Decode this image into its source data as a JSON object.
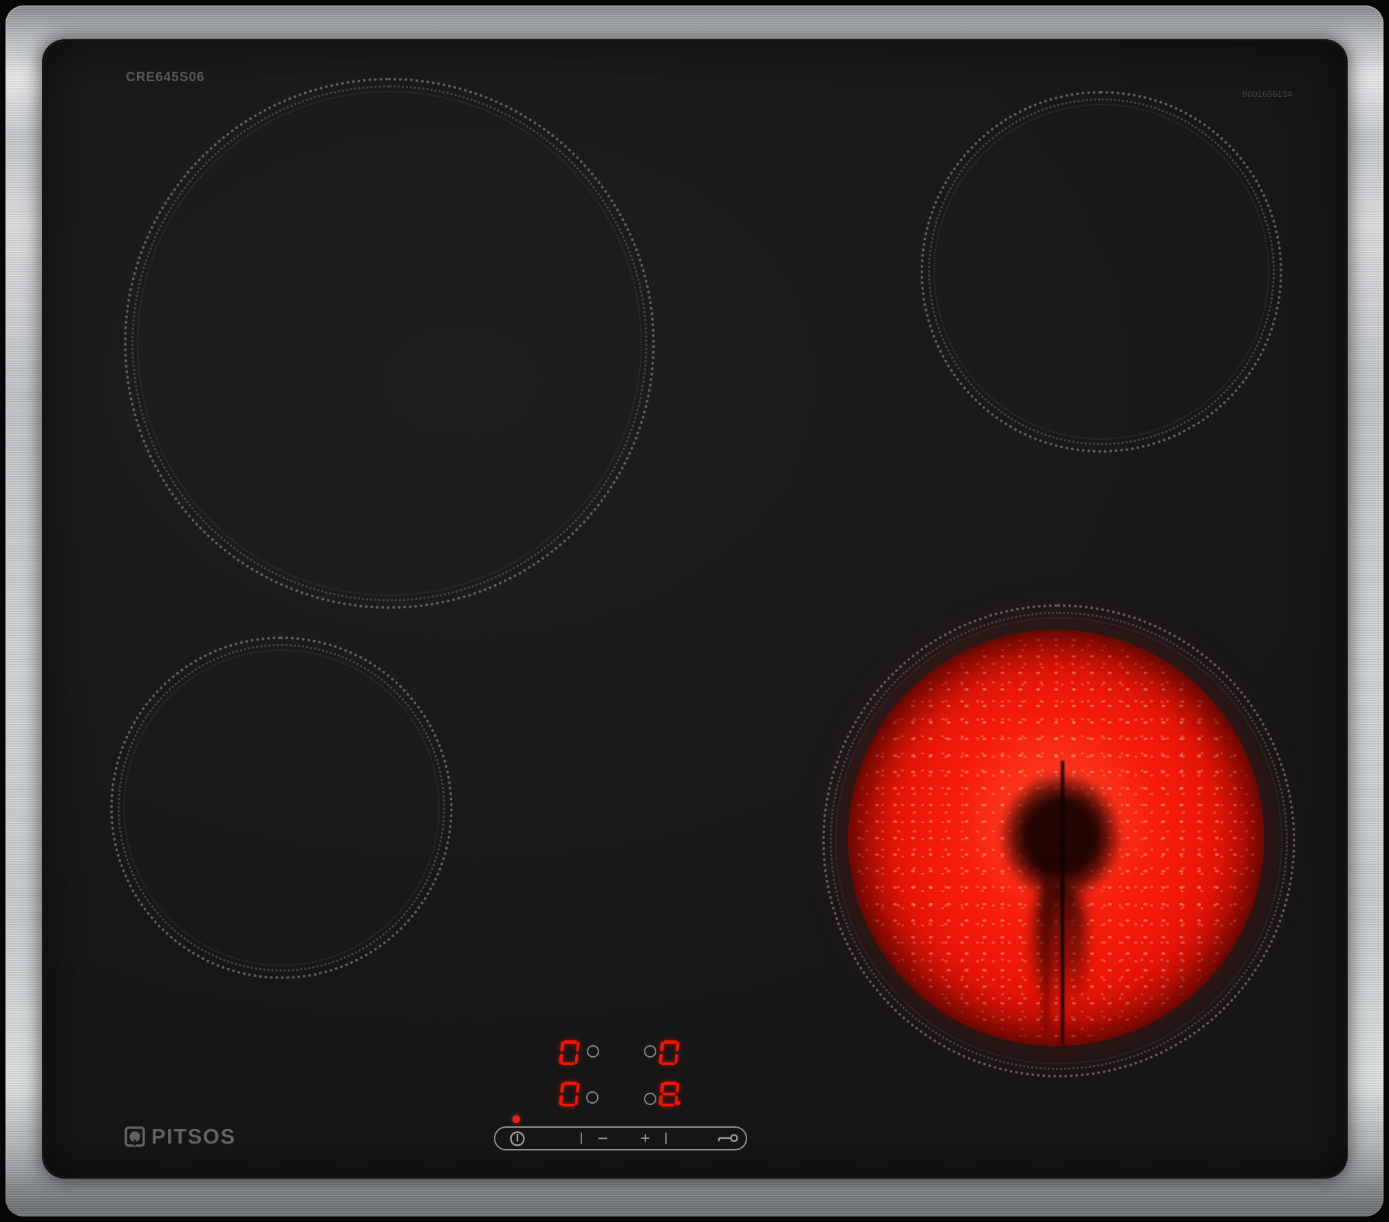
{
  "product": {
    "model": "CRE645S06",
    "serial": "9001606134",
    "brand": "PITSOS"
  },
  "colors": {
    "glass": "#1a1a1b",
    "metal": "#c9cccf",
    "digit_red": "#f21408",
    "indicator_red": "#e02518",
    "glow_red": "#e81405",
    "ring_dot_gray": "#6f6f6f",
    "label_gray": "#5c5c5c"
  },
  "burners": [
    {
      "position": "rear-left",
      "state": "off",
      "relative_size": "large"
    },
    {
      "position": "rear-right",
      "state": "off",
      "relative_size": "medium"
    },
    {
      "position": "front-left",
      "state": "off",
      "relative_size": "medium"
    },
    {
      "position": "front-right",
      "state": "heating",
      "relative_size": "large",
      "level": "8"
    }
  ],
  "displays": {
    "zones": [
      {
        "zone": "left-rear",
        "level": "0",
        "indicator_side": "right",
        "dot": false
      },
      {
        "zone": "right-rear",
        "level": "0",
        "indicator_side": "left",
        "dot": false
      },
      {
        "zone": "left-front",
        "level": "0",
        "indicator_side": "right",
        "dot": false
      },
      {
        "zone": "right-front",
        "level": "8",
        "indicator_side": "left",
        "dot": true
      }
    ]
  },
  "controls": {
    "power_led": "on",
    "minus_label": "−",
    "plus_label": "+"
  }
}
